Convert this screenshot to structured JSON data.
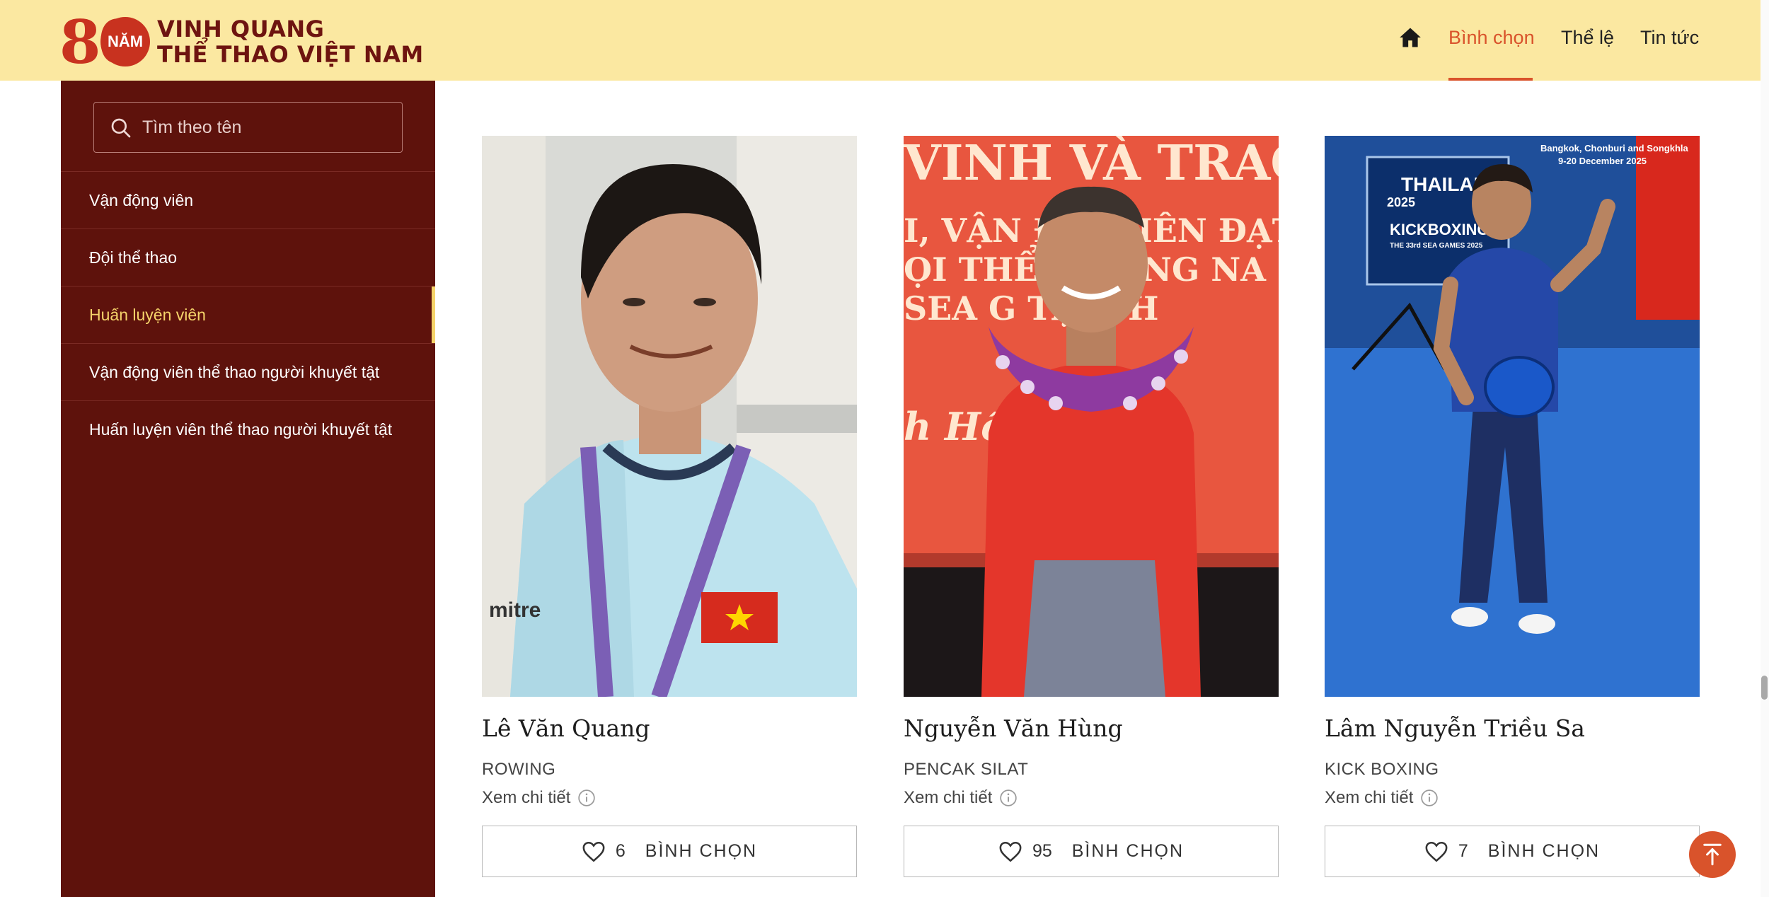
{
  "brand": {
    "number": "80",
    "badge": "NĂM",
    "line1": "VINH QUANG",
    "line2": "THỂ THAO VIỆT NAM"
  },
  "nav": {
    "items": [
      {
        "label": "Bình chọn",
        "active": true
      },
      {
        "label": "Thể lệ",
        "active": false
      },
      {
        "label": "Tin tức",
        "active": false
      }
    ]
  },
  "search": {
    "placeholder": "Tìm theo tên",
    "value": ""
  },
  "sidebar": {
    "items": [
      {
        "label": "Vận động viên",
        "active": false
      },
      {
        "label": "Đội thể thao",
        "active": false
      },
      {
        "label": "Huấn luyện viên",
        "active": true
      },
      {
        "label": "Vận động viên thể thao người khuyết tật",
        "active": false
      },
      {
        "label": "Huấn luyện viên thể thao người khuyết tật",
        "active": false
      }
    ]
  },
  "cards": [
    {
      "name": "Lê Văn Quang",
      "sport": "ROWING",
      "detail": "Xem chi tiết",
      "votes": "6",
      "vote_label": "BÌNH CHỌN",
      "photo_text": [
        "mitre"
      ]
    },
    {
      "name": "Nguyễn Văn Hùng",
      "sport": "PENCAK SILAT",
      "detail": "Xem chi tiết",
      "votes": "95",
      "vote_label": "BÌNH CHỌN",
      "photo_text": [
        "VINH VÀ TRAO",
        "I, VẬN Đ  G VIÊN ĐẠT",
        "ỌI THỂ T  ĐÔNG NA",
        "SEA G     TẠI TH",
        "h Hồ          áng"
      ]
    },
    {
      "name": "Lâm Nguyễn Triều Sa",
      "sport": "KICK BOXING",
      "detail": "Xem chi tiết",
      "votes": "7",
      "vote_label": "BÌNH CHỌN",
      "photo_text": [
        "THAILAND",
        "2025",
        "KICKBOXING",
        "THE 33rd SEA GAMES 2025",
        "Bangkok, Chonburi and Songkhla",
        "9-20 December 2025"
      ]
    }
  ],
  "colors": {
    "header_bg": "#fbe8a1",
    "sidebar_bg": "#5e120c",
    "accent": "#d9532b",
    "active_side": "#f5d36a",
    "brand_red": "#c8321f"
  }
}
